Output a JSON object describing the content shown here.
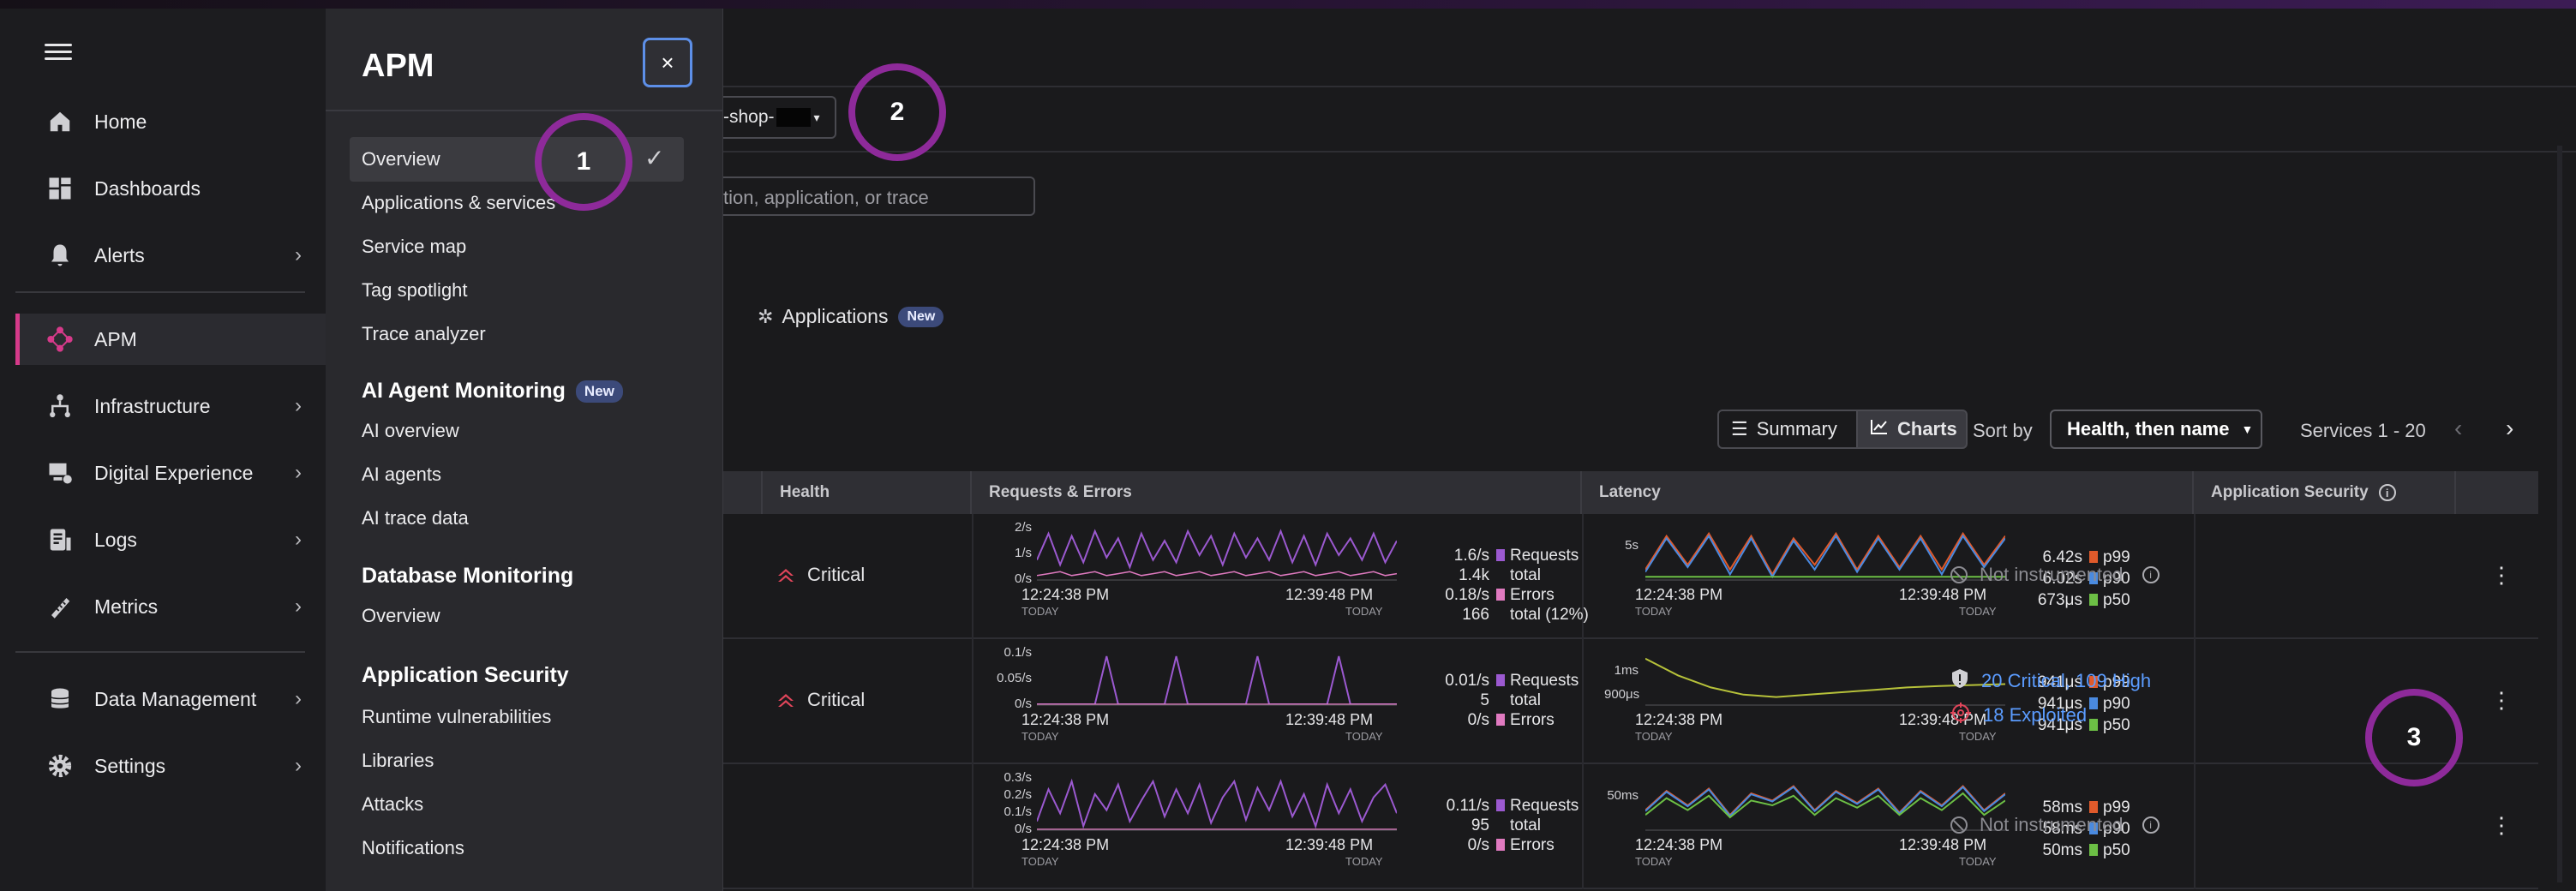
{
  "nav": {
    "items": [
      {
        "label": "Home",
        "icon": "home-icon"
      },
      {
        "label": "Dashboards",
        "icon": "dashboards-icon"
      },
      {
        "label": "Alerts",
        "icon": "bell-icon"
      },
      {
        "label": "APM",
        "icon": "apm-icon"
      },
      {
        "label": "Infrastructure",
        "icon": "infrastructure-icon"
      },
      {
        "label": "Digital Experience",
        "icon": "digital-experience-icon"
      },
      {
        "label": "Logs",
        "icon": "logs-icon"
      },
      {
        "label": "Metrics",
        "icon": "metrics-icon"
      },
      {
        "label": "Data Management",
        "icon": "database-icon"
      },
      {
        "label": "Settings",
        "icon": "gear-icon"
      }
    ],
    "accent_color": "#d63a8a"
  },
  "flyout": {
    "title": "APM",
    "close_label": "×",
    "items": [
      "Overview",
      "Applications & services",
      "Service map",
      "Tag spotlight",
      "Trace analyzer"
    ],
    "ai_section": {
      "title": "AI Agent Monitoring",
      "badge": "New",
      "items": [
        "AI overview",
        "AI agents",
        "AI trace data"
      ]
    },
    "db_section": {
      "title": "Database Monitoring",
      "items": [
        "Overview"
      ]
    },
    "sec_section": {
      "title": "Application Security",
      "items": [
        "Runtime vulnerabilities",
        "Libraries",
        "Attacks",
        "Notifications"
      ]
    }
  },
  "main": {
    "env_value": "-shop-",
    "search_placeholder": "tion, application, or trace",
    "apps_tab": {
      "label": "Applications",
      "badge": "New"
    },
    "toolbar": {
      "summary": "Summary",
      "charts": "Charts",
      "sort_label": "Sort by",
      "sort_value": "Health, then name",
      "count": "Services 1 - 20"
    },
    "table": {
      "headers": [
        "Health",
        "Requests & Errors",
        "Latency",
        "Application Security"
      ],
      "rows": [
        {
          "health": "Critical",
          "req_ticks": [
            "2/s",
            "1/s",
            "0/s"
          ],
          "lat_ticks": [
            "5s"
          ],
          "time_start": "12:24:38 PM",
          "time_end": "12:39:48 PM",
          "today": "TODAY",
          "stats": [
            {
              "v": "1.6/s",
              "l": "Requests"
            },
            {
              "v": "1.4k",
              "l": "total"
            },
            {
              "v": "0.18/s",
              "l": "Errors"
            },
            {
              "v": "166",
              "l": "total (12%)"
            }
          ],
          "lat": [
            {
              "v": "6.42s",
              "l": "p99"
            },
            {
              "v": "6.02s",
              "l": "p90"
            },
            {
              "v": "673μs",
              "l": "p50"
            }
          ],
          "security": "Not instrumented"
        },
        {
          "health": "Critical",
          "req_ticks": [
            "0.1/s",
            "0.05/s",
            "0/s"
          ],
          "lat_ticks": [
            "1ms",
            "900μs"
          ],
          "time_start": "12:24:38 PM",
          "time_end": "12:39:48 PM",
          "today": "TODAY",
          "stats": [
            {
              "v": "0.01/s",
              "l": "Requests"
            },
            {
              "v": "5",
              "l": "total"
            },
            {
              "v": "0/s",
              "l": "Errors"
            }
          ],
          "lat": [
            {
              "v": "941μs",
              "l": "p99"
            },
            {
              "v": "941μs",
              "l": "p90"
            },
            {
              "v": "941μs",
              "l": "p50"
            }
          ],
          "security_critical": "20 Critical, 109 High",
          "security_exploited": "18 Exploited"
        },
        {
          "req_ticks": [
            "0.3/s",
            "0.2/s",
            "0.1/s",
            "0/s"
          ],
          "lat_ticks": [
            "50ms"
          ],
          "time_start": "12:24:38 PM",
          "time_end": "12:39:48 PM",
          "today": "TODAY",
          "stats": [
            {
              "v": "0.11/s",
              "l": "Requests"
            },
            {
              "v": "95",
              "l": "total"
            },
            {
              "v": "0/s",
              "l": "Errors"
            }
          ],
          "lat": [
            {
              "v": "58ms",
              "l": "p99"
            },
            {
              "v": "58ms",
              "l": "p90"
            },
            {
              "v": "50ms",
              "l": "p50"
            }
          ],
          "security": "Not instrumented"
        }
      ]
    }
  },
  "annotations": [
    "1",
    "2",
    "3"
  ],
  "colors": {
    "requests": "#9b59d0",
    "errors": "#e07ac0",
    "p99": "#e05a2b",
    "p90": "#4a8ae0",
    "p50": "#6cbf45"
  }
}
